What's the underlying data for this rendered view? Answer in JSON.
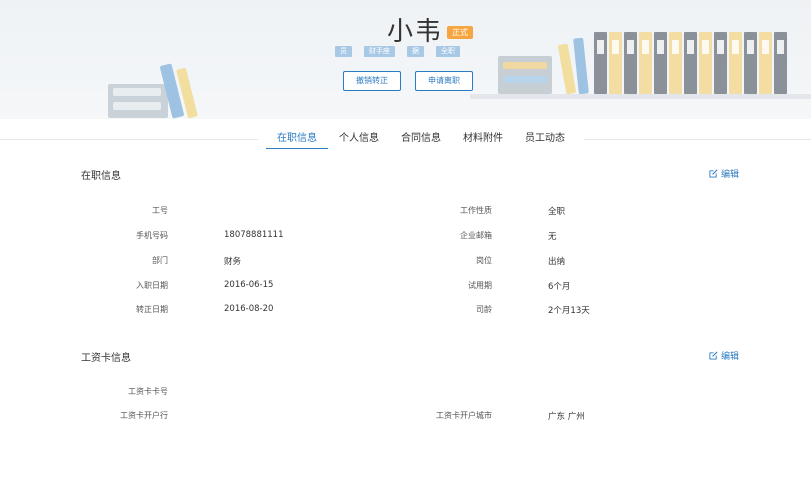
{
  "profile": {
    "name": "小韦",
    "status": "正式",
    "tags": [
      "员",
      "财手座",
      "据",
      "全职"
    ],
    "btn_undo": "撤销转正",
    "btn_resign": "申请离职"
  },
  "tabs": [
    "在职信息",
    "个人信息",
    "合同信息",
    "材料附件",
    "员工动态"
  ],
  "job_section": {
    "title": "在职信息",
    "edit": "编辑",
    "left_labels": [
      "工号",
      "手机号码",
      "部门",
      "入职日期",
      "转正日期"
    ],
    "left_values": [
      "",
      "18078881111",
      "财务",
      "2016-06-15",
      "2016-08-20"
    ],
    "right_labels": [
      "工作性质",
      "企业邮箱",
      "岗位",
      "试用期",
      "司龄"
    ],
    "right_values": [
      "全职",
      "无",
      "出纳",
      "6个月",
      "2个月13天"
    ]
  },
  "salary_section": {
    "title": "工资卡信息",
    "edit": "编辑",
    "card_no_label": "工资卡卡号",
    "card_no_value": "",
    "bank_label": "工资卡开户行",
    "bank_value": "",
    "city_label": "工资卡开户城市",
    "city_value": "广东 广州"
  },
  "colors": {
    "accent": "#2b7bc2",
    "badge": "#f7a541",
    "tag": "#a8c9e6"
  }
}
